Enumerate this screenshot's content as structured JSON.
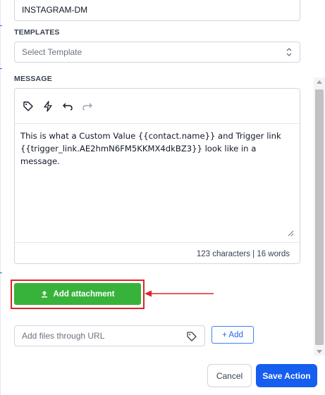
{
  "channel": {
    "value": "INSTAGRAM-DM"
  },
  "templates": {
    "label": "TEMPLATES",
    "placeholder": "Select Template"
  },
  "message": {
    "label": "MESSAGE",
    "body": "This is what a Custom Value {{contact.name}} and Trigger link\n{{trigger_link.AE2hmN6FM5KKMX4dkBZ3}} look like in a message.",
    "stats": "123 characters | 16 words",
    "toolbar_icons": [
      "tag-icon",
      "lightning-icon",
      "undo-icon",
      "redo-icon"
    ]
  },
  "attachment": {
    "button_label": "Add attachment",
    "url_placeholder": "Add files through URL",
    "add_label": "+ Add"
  },
  "footer": {
    "cancel_label": "Cancel",
    "save_label": "Save Action"
  },
  "colors": {
    "attach_green": "#37b33b",
    "highlight_red": "#dc2626",
    "primary_blue": "#155eef"
  }
}
